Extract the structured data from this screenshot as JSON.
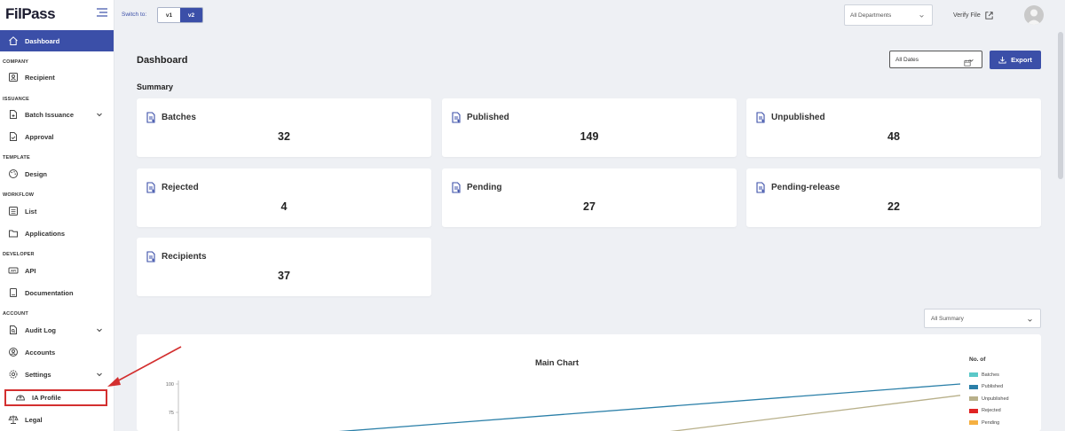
{
  "app": {
    "logo": "FilPass"
  },
  "topbar": {
    "switch_label": "Switch to:",
    "versions": [
      "v1",
      "v2"
    ],
    "active_version": "v2",
    "department": "All Departments",
    "verify_label": "Verify File"
  },
  "sidebar": {
    "dashboard": "Dashboard",
    "sections": {
      "company": "COMPANY",
      "issuance": "ISSUANCE",
      "template": "TEMPLATE",
      "workflow": "WORKFLOW",
      "developer": "DEVELOPER",
      "account": "ACCOUNT"
    },
    "items": {
      "recipient": "Recipient",
      "batch_issuance": "Batch Issuance",
      "approval": "Approval",
      "design": "Design",
      "list": "List",
      "applications": "Applications",
      "api": "API",
      "documentation": "Documentation",
      "audit_log": "Audit Log",
      "accounts": "Accounts",
      "settings": "Settings",
      "ia_profile": "IA Profile",
      "legal": "Legal"
    }
  },
  "main": {
    "title": "Dashboard",
    "summary_title": "Summary",
    "date_filter": "All Dates",
    "export_label": "Export",
    "summary_filter": "All Summary",
    "cards": [
      {
        "label": "Batches",
        "value": "32"
      },
      {
        "label": "Published",
        "value": "149"
      },
      {
        "label": "Unpublished",
        "value": "48"
      },
      {
        "label": "Rejected",
        "value": "4"
      },
      {
        "label": "Pending",
        "value": "27"
      },
      {
        "label": "Pending-release",
        "value": "22"
      },
      {
        "label": "Recipients",
        "value": "37"
      }
    ]
  },
  "chart_data": {
    "type": "line",
    "title": "Main Chart",
    "legend_title": "No. of",
    "y_ticks": [
      "100",
      "75"
    ],
    "legend": [
      {
        "name": "Batches",
        "color": "#5bc8c8"
      },
      {
        "name": "Published",
        "color": "#2a7fa8"
      },
      {
        "name": "Unpublished",
        "color": "#b8b08a"
      },
      {
        "name": "Rejected",
        "color": "#e02424"
      },
      {
        "name": "Pending",
        "color": "#f5b041"
      }
    ],
    "series": [
      {
        "name": "Published",
        "end_value": 100
      },
      {
        "name": "Unpublished",
        "end_value": 90
      }
    ]
  },
  "colors": {
    "accent": "#3b4fa8",
    "annotation": "#d32f2f"
  }
}
